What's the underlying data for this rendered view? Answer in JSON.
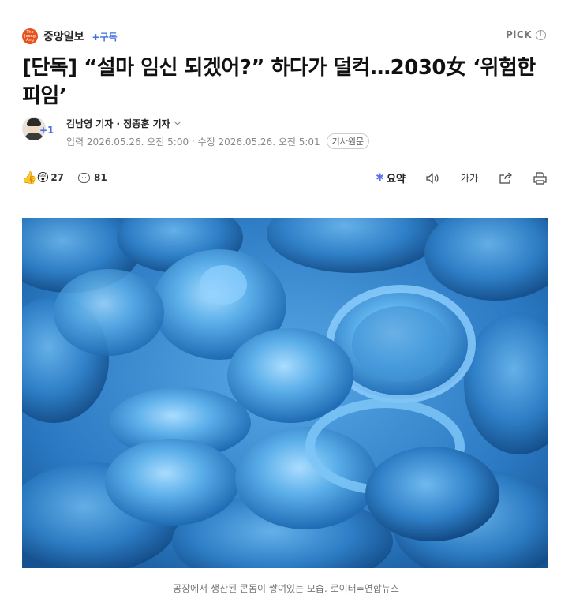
{
  "press": {
    "logo_text": "The\nJoong\nAng",
    "name": "중앙일보",
    "subscribe_label": "+구독"
  },
  "pick": {
    "label": "PiCK",
    "info_icon": "info-icon"
  },
  "article": {
    "headline": "[단독] “설마 임신 되겠어?” 하다가 덜컥…2030女 ‘위험한 피임’",
    "reporters": "김남영 기자 · 정종훈 기자",
    "more_reporters": "+1",
    "input_label": "입력",
    "input_date": "2026.05.26. 오전 5:00",
    "edit_label": "수정",
    "edit_date": "2026.05.26. 오전 5:01",
    "original_label": "기사원문"
  },
  "reactions": {
    "like_count": "27",
    "comment_count": "81"
  },
  "tools": {
    "summary_label": "요약",
    "font_size_label": "가가"
  },
  "photo": {
    "caption": "공장에서 생산된 콘돔이 쌓여있는 모습. 로이터=연합뉴스"
  },
  "colors": {
    "press_logo": "#e8501c",
    "accent_blue": "#3f6fe0",
    "photo_blue": "#2f7fc9"
  }
}
